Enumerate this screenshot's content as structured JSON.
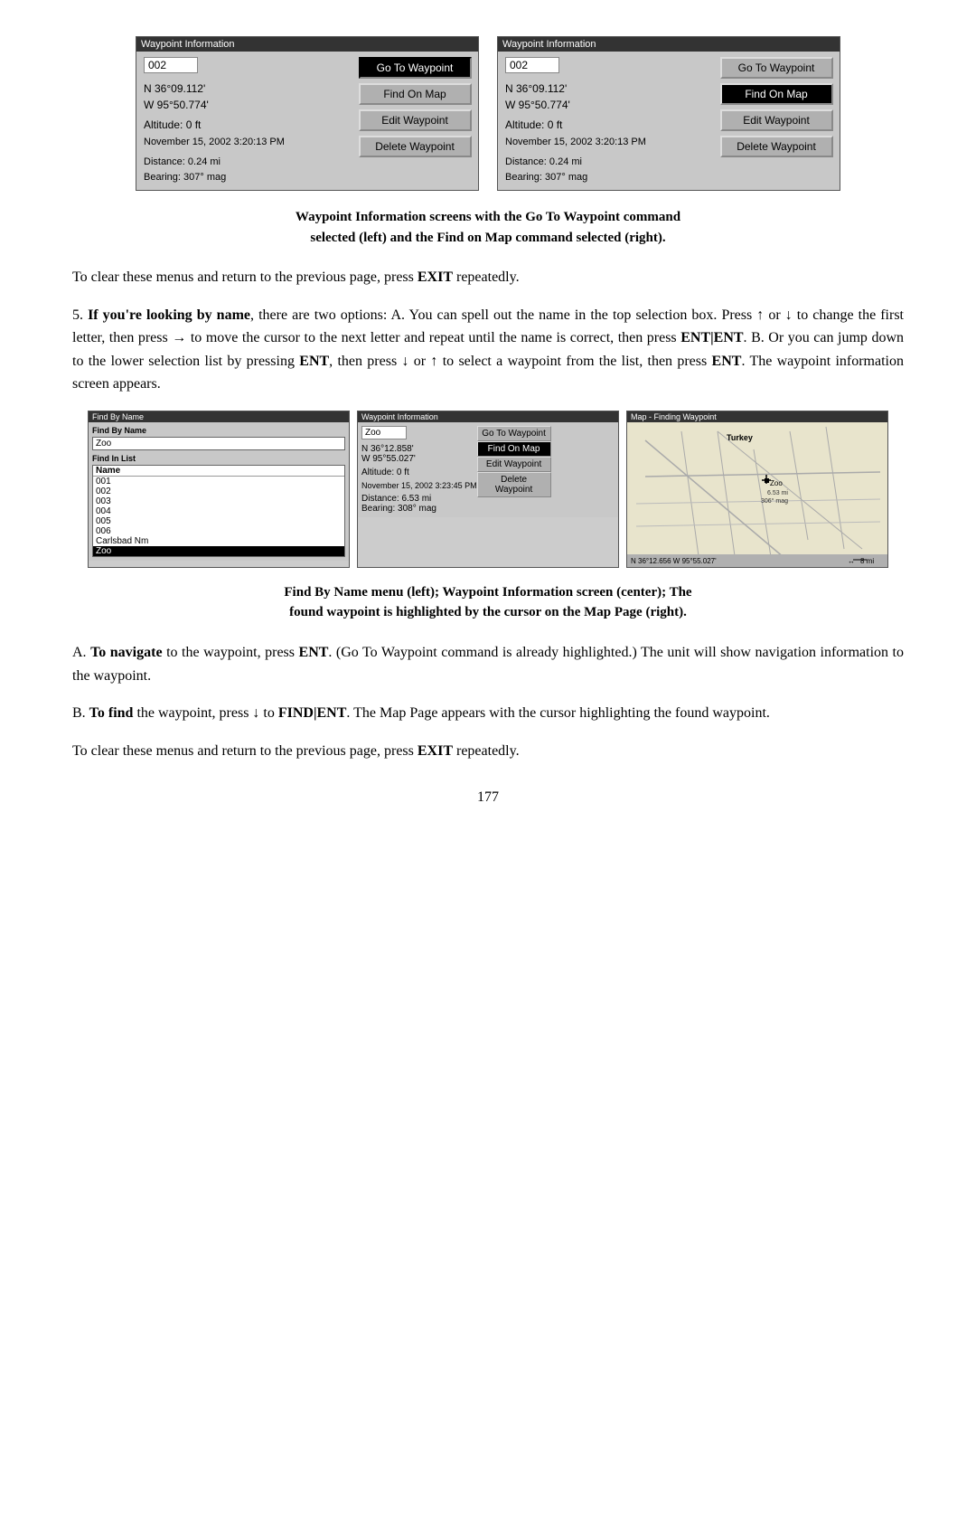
{
  "page": {
    "number": "177"
  },
  "top_screenshots": {
    "left": {
      "title": "Waypoint Information",
      "waypoint_id": "002",
      "lat": "N  36°09.112'",
      "lon": "W  95°50.774'",
      "altitude": "Altitude:  0 ft",
      "datetime": "November 15, 2002 3:20:13 PM",
      "distance_label": "Distance:",
      "distance_value": "0.24 mi",
      "bearing_label": "Bearing:",
      "bearing_value": "307° mag",
      "buttons": [
        {
          "label": "Go To Waypoint",
          "selected": true
        },
        {
          "label": "Find On Map",
          "selected": false
        },
        {
          "label": "Edit Waypoint",
          "selected": false
        },
        {
          "label": "Delete Waypoint",
          "selected": false
        }
      ]
    },
    "right": {
      "title": "Waypoint Information",
      "waypoint_id": "002",
      "lat": "N  36°09.112'",
      "lon": "W  95°50.774'",
      "altitude": "Altitude:  0 ft",
      "datetime": "November 15, 2002 3:20:13 PM",
      "distance_label": "Distance:",
      "distance_value": "0.24 mi",
      "bearing_label": "Bearing:",
      "bearing_value": "307° mag",
      "buttons": [
        {
          "label": "Go To Waypoint",
          "selected": false
        },
        {
          "label": "Find On Map",
          "selected": true
        },
        {
          "label": "Edit Waypoint",
          "selected": false
        },
        {
          "label": "Delete Waypoint",
          "selected": false
        }
      ]
    }
  },
  "caption1_line1": "Waypoint Information screens with the Go To Waypoint command",
  "caption1_line2": "selected (left) and the Find on Map command selected (right).",
  "para1": "To clear these menus and return to the previous page, press ",
  "para1_bold": "EXIT",
  "para1_cont": " repeatedly.",
  "para2_num": "5.",
  "para2_bold1": "If you're looking by name",
  "para2_cont": ", there are two options: ",
  "para2_A": "A.",
  "para2_A_cont": " You can spell out the name in the top selection box. Press ↑ or ↓ to change the first letter, then press → to move the cursor to the next letter and repeat until the name is correct, then press ",
  "para2_bold2": "ENT|ENT",
  "para2_B": ". B.",
  "para2_B_cont": " Or you can jump down to the lower selection list by pressing ",
  "para2_bold3": "ENT",
  "para2_mid": ", then press ↓ or ↑ to select a waypoint from the list, then press ",
  "para2_bold4": "ENT",
  "para2_end": ". The waypoint information screen appears.",
  "bottom_screenshots": {
    "find_by_name": {
      "title": "Find By Name",
      "find_label": "Find By Name",
      "name_input": "Zoo",
      "list_label": "Find In List",
      "col_header": "Name",
      "items": [
        "001",
        "002",
        "003",
        "004",
        "005",
        "006",
        "Carlsbad Nm",
        "Zoo"
      ],
      "selected_index": 7
    },
    "waypoint_info": {
      "title": "Waypoint Information",
      "waypoint_id": "Zoo",
      "lat": "N  36°12.858'",
      "lon": "W  95°55.027'",
      "altitude": "Altitude:  0 ft",
      "datetime": "November 15, 2002 3:23:45 PM",
      "distance_label": "Distance:",
      "distance_value": "6.53 mi",
      "bearing_label": "Bearing:",
      "bearing_value": "308° mag",
      "buttons": [
        {
          "label": "Go To Waypoint",
          "selected": false
        },
        {
          "label": "Find On Map",
          "selected": true
        },
        {
          "label": "Edit Waypoint",
          "selected": false
        },
        {
          "label": "Delete Waypoint",
          "selected": false
        }
      ]
    },
    "map": {
      "title": "Map - Finding Waypoint",
      "location_label": "Turkey",
      "zoo_label": "Zoo",
      "dist_label": "6.53 mi",
      "bearing_label": "306° mag",
      "bottom_lat": "N  36°12.656",
      "bottom_lon": "W  95°55.027'",
      "zoom": "8 mi"
    }
  },
  "caption2_line1": "Find By Name menu (left); Waypoint Information screen (center); The",
  "caption2_line2": "found waypoint is highlighted by the cursor on the Map Page (right).",
  "para_A": "A.",
  "para_A_bold": "To navigate",
  "para_A_cont": " to the waypoint, press ",
  "para_A_bold2": "ENT",
  "para_A_cont2": ". (Go To Waypoint command is already highlighted.) The unit will show navigation information to the waypoint.",
  "para_B_prefix": "B.",
  "para_B_bold": "To find",
  "para_B_cont": " the waypoint, press ↓ to ",
  "para_B_bold2": "FIND|ENT",
  "para_B_cont2": ". The Map Page appears with the cursor highlighting the found waypoint.",
  "para3": "To clear these menus and return to the previous page, press ",
  "para3_bold": "EXIT",
  "para3_cont": " repeatedly."
}
